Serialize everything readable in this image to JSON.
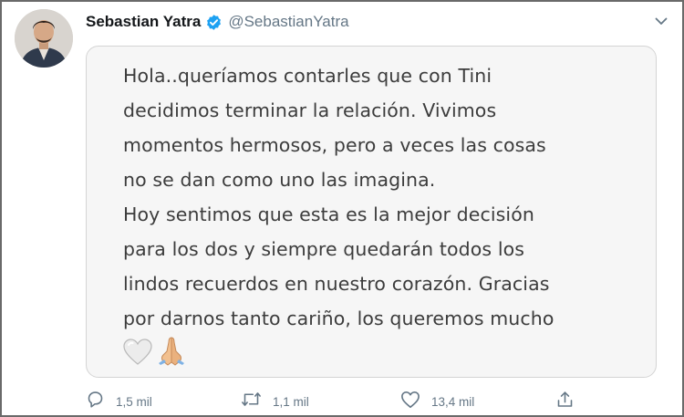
{
  "tweet": {
    "author": {
      "display_name": "Sebastian Yatra",
      "handle": "@SebastianYatra",
      "verified": true
    },
    "statement_lines": [
      "Hola..queríamos contarles que con Tini",
      "decidimos terminar la relación. Vivimos",
      "momentos hermosos, pero a veces las cosas",
      "no se dan como uno las imagina.",
      "Hoy sentimos que esta es la mejor decisión",
      "para los dos y siempre quedarán todos los",
      "lindos recuerdos en nuestro corazón. Gracias",
      "por darnos tanto cariño, los queremos mucho"
    ],
    "statement_emojis": [
      "white-heart-icon",
      "folded-hands-icon"
    ],
    "metrics": {
      "replies": "1,5 mil",
      "retweets": "1,1 mil",
      "likes": "13,4 mil"
    }
  },
  "colors": {
    "verified_blue": "#1da1f2",
    "secondary_text": "#657786",
    "card_background": "#f6f6f6",
    "statement_text": "#3c3c3c"
  }
}
